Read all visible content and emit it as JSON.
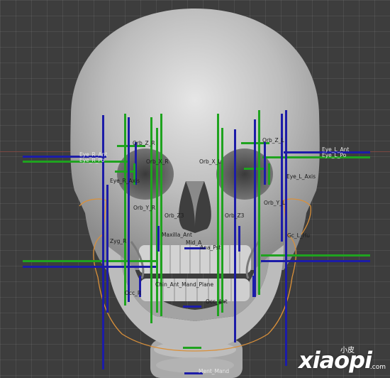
{
  "viewport": {
    "name": "3D Viewport",
    "corner_text": "",
    "colors": {
      "background": "#3d3d3d",
      "skull": "#c9c9c9",
      "guide_green": "#1fa31f",
      "guide_blue": "#1c1ca8",
      "face_outline": "#d9903a"
    }
  },
  "labels": [
    {
      "id": "orb-z-r",
      "text": "Orb_Z_R"
    },
    {
      "id": "orb-z-l",
      "text": "Orb_Z_L"
    },
    {
      "id": "eye-r-ant",
      "text": "Eye_R_Ant"
    },
    {
      "id": "eye-l-ant",
      "text": "Eye_L_Ant"
    },
    {
      "id": "eye-r-pos",
      "text": "Eye_R_Po"
    },
    {
      "id": "eye-l-pos",
      "text": "Eye_L_Po"
    },
    {
      "id": "orb-x-r",
      "text": "Orb_X_R"
    },
    {
      "id": "orb-x-l",
      "text": "Orb_X_L"
    },
    {
      "id": "eye-r-axis",
      "text": "Eye_R_Axis"
    },
    {
      "id": "eye-l-axis",
      "text": "Eye_L_Axis"
    },
    {
      "id": "orb-y-r",
      "text": "Orb_Y_R"
    },
    {
      "id": "orb-y-l",
      "text": "Orb_Y_L"
    },
    {
      "id": "orb-z3-r",
      "text": "Orb_Z3"
    },
    {
      "id": "orb-z3-l",
      "text": "Orb_Z3"
    },
    {
      "id": "zyg-r",
      "text": "Zyg_R"
    },
    {
      "id": "zyg-l",
      "text": "Gc_L_Hu"
    },
    {
      "id": "maxilla",
      "text": "Maxilla_Ant"
    },
    {
      "id": "midline-a",
      "text": "Mid_A"
    },
    {
      "id": "midline-b",
      "text": "Ana_Pst"
    },
    {
      "id": "chin-ant",
      "text": "Chin_Ant_Mand_Plane"
    },
    {
      "id": "occ-r",
      "text": "Occ_R"
    },
    {
      "id": "occ-l",
      "text": "Occ_Ant"
    },
    {
      "id": "menton",
      "text": "Ment_Mand"
    }
  ],
  "watermark": {
    "main": "xiaopi",
    "sub": "小皮",
    "suffix": ".com"
  }
}
